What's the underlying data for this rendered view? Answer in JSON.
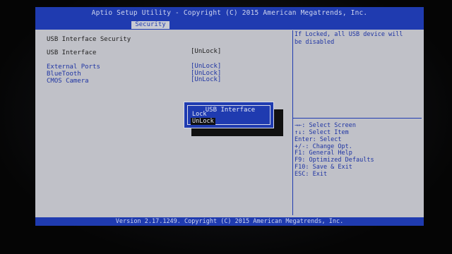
{
  "header": {
    "title": "Aptio Setup Utility - Copyright (C) 2015 American Megatrends, Inc.",
    "active_tab": "Security"
  },
  "main": {
    "section_title": "USB Interface Security",
    "items": [
      {
        "label": "USB Interface",
        "value": "[UnLock]"
      },
      {
        "label": "External Ports",
        "value": "[UnLock]"
      },
      {
        "label": "BlueTooth",
        "value": "[UnLock]"
      },
      {
        "label": "CMOS Camera",
        "value": "[UnLock]"
      }
    ]
  },
  "help": {
    "line1": "If Locked, all USB device will",
    "line2": "be disabled"
  },
  "keys": [
    "→←: Select Screen",
    "↑↓: Select Item",
    "Enter: Select",
    "+/-: Change Opt.",
    "F1: General Help",
    "F9: Optimized Defaults",
    "F10: Save & Exit",
    "ESC: Exit"
  ],
  "popup": {
    "title": "USB Interface",
    "options": [
      "Lock",
      "UnLock"
    ],
    "selected": "UnLock"
  },
  "footer": {
    "version": "Version 2.17.1249. Copyright (C) 2015 American Megatrends, Inc."
  }
}
